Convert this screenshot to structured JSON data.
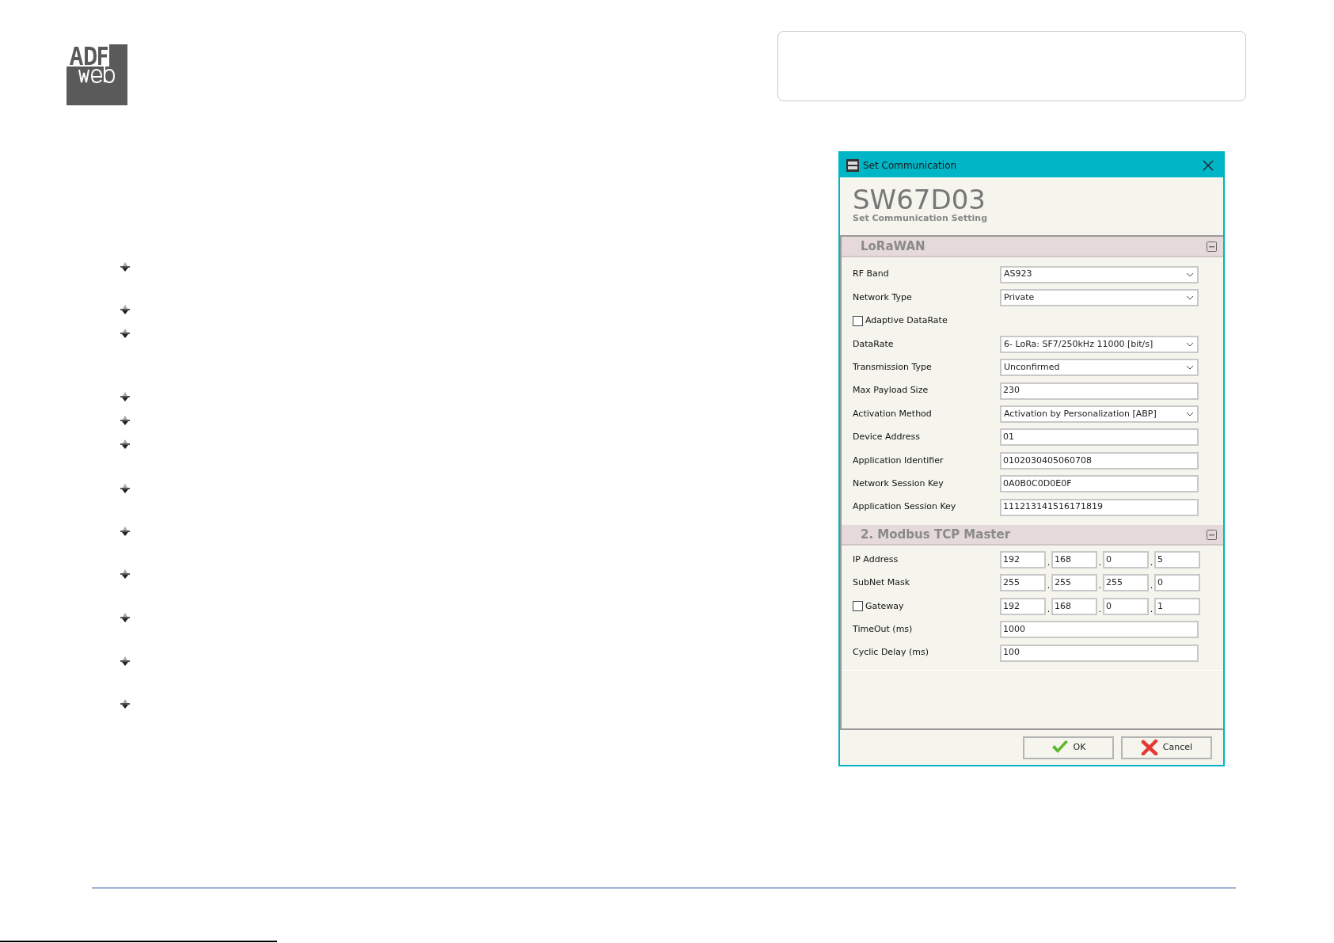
{
  "dialog": {
    "title": "Set Communication",
    "product": "SW67D03",
    "subtitle": "Set Communication Setting",
    "sections": [
      {
        "title": "LoRaWAN",
        "rows": [
          {
            "kind": "select",
            "label": "RF Band",
            "value": "AS923"
          },
          {
            "kind": "select",
            "label": "Network Type",
            "value": "Private"
          },
          {
            "kind": "checkbox",
            "label": "Adaptive DataRate",
            "checked": false
          },
          {
            "kind": "select",
            "label": "DataRate",
            "value": "6- LoRa: SF7/250kHz 11000 [bit/s]"
          },
          {
            "kind": "select",
            "label": "Transmission Type",
            "value": "Unconfirmed"
          },
          {
            "kind": "text",
            "label": "Max Payload Size",
            "value": "230"
          },
          {
            "kind": "select",
            "label": "Activation Method",
            "value": "Activation by Personalization [ABP]"
          },
          {
            "kind": "text",
            "label": "Device Address",
            "value": "01"
          },
          {
            "kind": "text",
            "label": "Application Identifier",
            "value": "0102030405060708"
          },
          {
            "kind": "text",
            "label": "Network Session Key",
            "value": "0A0B0C0D0E0F"
          },
          {
            "kind": "text",
            "label": "Application Session Key",
            "value": "111213141516171819"
          }
        ]
      },
      {
        "title": "2. Modbus TCP Master",
        "rows": [
          {
            "kind": "ip",
            "label": "IP Address",
            "separator": ".",
            "octets": [
              "192",
              "168",
              "0",
              "5"
            ]
          },
          {
            "kind": "ip",
            "label": "SubNet Mask",
            "separator": ".",
            "octets": [
              "255",
              "255",
              "255",
              "0"
            ]
          },
          {
            "kind": "ip-checkbox",
            "label": "Gateway",
            "checked": false,
            "separator": ".",
            "octets": [
              "192",
              "168",
              "0",
              "1"
            ]
          },
          {
            "kind": "text",
            "label": "TimeOut (ms)",
            "value": "1000"
          },
          {
            "kind": "text",
            "label": "Cyclic Delay (ms)",
            "value": "100"
          }
        ]
      }
    ],
    "buttons": [
      {
        "kind": "ok",
        "label": "OK"
      },
      {
        "kind": "cancel",
        "label": "Cancel"
      }
    ]
  }
}
